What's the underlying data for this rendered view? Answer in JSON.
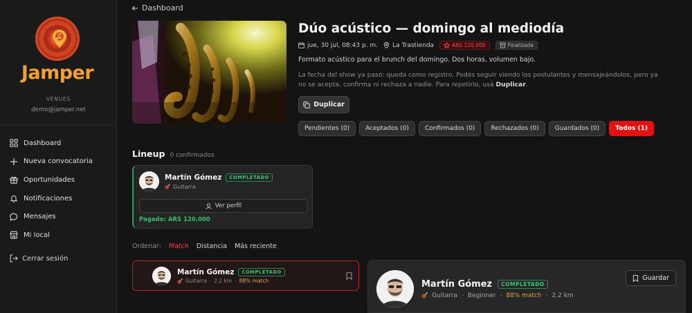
{
  "sidebar": {
    "brand": "Jamper",
    "role": "VENUES",
    "email": "demo@jamper.net",
    "items": [
      {
        "label": "Dashboard",
        "icon": "grid-icon"
      },
      {
        "label": "Nueva convocatoria",
        "icon": "plus-icon"
      },
      {
        "label": "Oportunidades",
        "icon": "gift-icon"
      },
      {
        "label": "Notificaciones",
        "icon": "bell-icon"
      },
      {
        "label": "Mensajes",
        "icon": "chat-icon"
      },
      {
        "label": "Mi local",
        "icon": "store-icon"
      }
    ],
    "logout": "Cerrar sesión"
  },
  "header": {
    "back": "Dashboard"
  },
  "event": {
    "title": "Dúo acústico — domingo al mediodía",
    "date": "jue, 30 jul, 08:43 p. m.",
    "venue": "La Trastienda",
    "price": "ARS 120.000",
    "status": "Finalizada",
    "description": "Formato acústico para el brunch del domingo. Dos horas, volumen bajo.",
    "note_text": "La fecha del show ya pasó: queda como registro. Podés seguir viendo los postulantes y mensajeándolos, pero ya no se acepta, confirma ni rechaza a nadie. Para repetirlo, usá ",
    "note_bold": "Duplicar",
    "note_end": ".",
    "duplicate_label": "Duplicar"
  },
  "filters": [
    {
      "label": "Pendientes (0)",
      "active": false
    },
    {
      "label": "Aceptados (0)",
      "active": false
    },
    {
      "label": "Confirmados (0)",
      "active": false
    },
    {
      "label": "Rechazados (0)",
      "active": false
    },
    {
      "label": "Guardados (0)",
      "active": false
    },
    {
      "label": "Todos (1)",
      "active": true
    }
  ],
  "lineup": {
    "title": "Lineup",
    "count": "0 confirmados",
    "card": {
      "name": "Martín Gómez",
      "badge": "COMPLETADO",
      "instrument": "Guitarra",
      "profile_label": "Ver perfil",
      "paid": "Pagado: ARS 120.000"
    }
  },
  "sort": {
    "label": "Ordenar:",
    "options": [
      "Match",
      "Distancia",
      "Más reciente"
    ],
    "active": "Match"
  },
  "candidate": {
    "name": "Martín Gómez",
    "badge": "COMPLETADO",
    "instrument": "Guitarra",
    "distance": "2.2 km",
    "match": "88% match"
  },
  "detail": {
    "name": "Martín Gómez",
    "badge": "COMPLETADO",
    "instrument": "Guitarra",
    "level": "Beginner",
    "match": "88% match",
    "distance": "2.2 km",
    "save_label": "Guardar"
  },
  "colors": {
    "accent": "#e31212",
    "brand": "#f0a030",
    "success": "#2fbf6e",
    "match": "#e7a23c"
  }
}
